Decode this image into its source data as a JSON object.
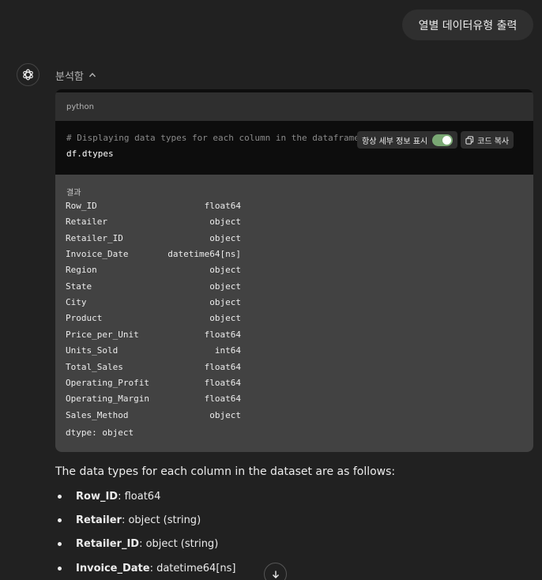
{
  "user_message": "열별 데이터유형 출력",
  "analysis": {
    "label": "분석함"
  },
  "code_block": {
    "language": "python",
    "lines": [
      "# Displaying data types for each column in the dataframe",
      "df.dtypes"
    ],
    "always_show_details_label": "항상 세부 정보 표시",
    "always_show_details_on": true,
    "copy_label": "코드 복사"
  },
  "result": {
    "label": "결과",
    "rows": [
      {
        "name": "Row_ID",
        "dtype": "float64"
      },
      {
        "name": "Retailer",
        "dtype": "object"
      },
      {
        "name": "Retailer_ID",
        "dtype": "object"
      },
      {
        "name": "Invoice_Date",
        "dtype": "datetime64[ns]"
      },
      {
        "name": "Region",
        "dtype": "object"
      },
      {
        "name": "State",
        "dtype": "object"
      },
      {
        "name": "City",
        "dtype": "object"
      },
      {
        "name": "Product",
        "dtype": "object"
      },
      {
        "name": "Price_per_Unit",
        "dtype": "float64"
      },
      {
        "name": "Units_Sold",
        "dtype": "int64"
      },
      {
        "name": "Total_Sales",
        "dtype": "float64"
      },
      {
        "name": "Operating_Profit",
        "dtype": "float64"
      },
      {
        "name": "Operating_Margin",
        "dtype": "float64"
      },
      {
        "name": "Sales_Method",
        "dtype": "object"
      }
    ],
    "footer": "dtype: object"
  },
  "answer": {
    "intro": "The data types for each column in the dataset are as follows:",
    "bullets": [
      {
        "key": "Row_ID",
        "value": ": float64"
      },
      {
        "key": "Retailer",
        "value": ": object (string)"
      },
      {
        "key": "Retailer_ID",
        "value": ": object (string)"
      },
      {
        "key": "Invoice_Date",
        "value": ": datetime64[ns]"
      }
    ]
  },
  "icons": {
    "assistant": "openai-logo-icon",
    "toggle_chevron": "chevron-up-icon",
    "copy": "copy-icon",
    "scroll": "arrow-down-icon"
  }
}
